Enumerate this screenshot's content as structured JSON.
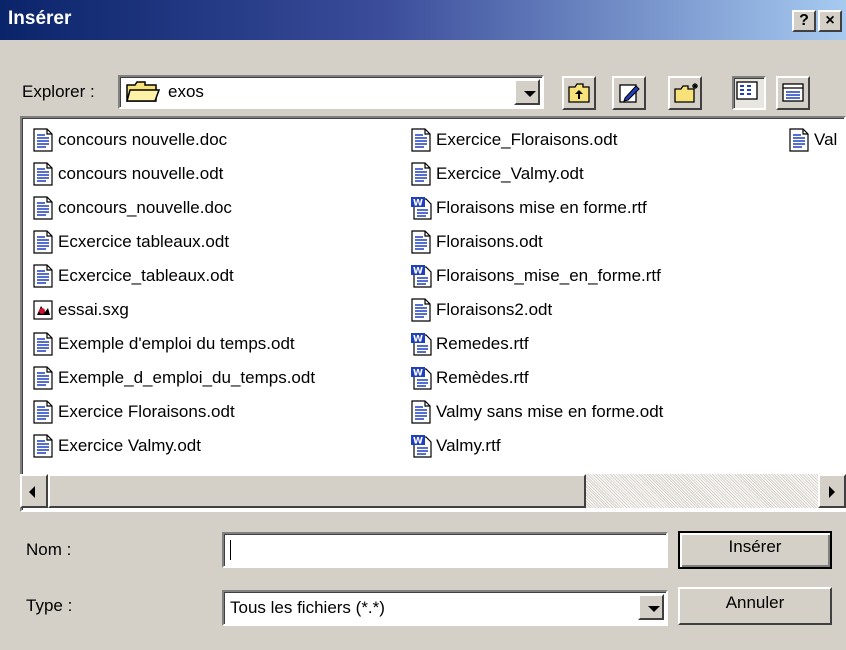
{
  "window": {
    "title": "Insérer",
    "help_button": "?",
    "close_button": "×"
  },
  "explorer": {
    "label": "Explorer :",
    "folder": "exos",
    "folder_icon": "folder-icon"
  },
  "toolbar": [
    {
      "name": "up-one-level-icon"
    },
    {
      "name": "edit-pencil-icon"
    },
    {
      "name": "new-folder-icon"
    },
    {
      "name": "list-view-icon"
    },
    {
      "name": "details-view-icon"
    }
  ],
  "files": {
    "col1": [
      {
        "name": "concours nouvelle.doc",
        "icon": "document-icon"
      },
      {
        "name": "concours nouvelle.odt",
        "icon": "document-icon"
      },
      {
        "name": "concours_nouvelle.doc",
        "icon": "document-icon"
      },
      {
        "name": "Ecxercice tableaux.odt",
        "icon": "document-icon"
      },
      {
        "name": "Ecxercice_tableaux.odt",
        "icon": "document-icon"
      },
      {
        "name": "essai.sxg",
        "icon": "sxg-file-icon"
      },
      {
        "name": "Exemple d'emploi du temps.odt",
        "icon": "document-icon"
      },
      {
        "name": "Exemple_d_emploi_du_temps.odt",
        "icon": "document-icon"
      },
      {
        "name": "Exercice Floraisons.odt",
        "icon": "document-icon"
      },
      {
        "name": "Exercice Valmy.odt",
        "icon": "document-icon"
      }
    ],
    "col2": [
      {
        "name": "Exercice_Floraisons.odt",
        "icon": "document-icon"
      },
      {
        "name": "Exercice_Valmy.odt",
        "icon": "document-icon"
      },
      {
        "name": "Floraisons mise en forme.rtf",
        "icon": "rtf-file-icon"
      },
      {
        "name": "Floraisons.odt",
        "icon": "document-icon"
      },
      {
        "name": "Floraisons_mise_en_forme.rtf",
        "icon": "rtf-file-icon"
      },
      {
        "name": "Floraisons2.odt",
        "icon": "document-icon"
      },
      {
        "name": "Remedes.rtf",
        "icon": "rtf-file-icon"
      },
      {
        "name": "Remèdes.rtf",
        "icon": "rtf-file-icon"
      },
      {
        "name": "Valmy sans mise en forme.odt",
        "icon": "document-icon"
      },
      {
        "name": "Valmy.rtf",
        "icon": "rtf-file-icon"
      }
    ],
    "col3": [
      {
        "name": "Val",
        "icon": "document-icon"
      }
    ]
  },
  "form": {
    "name_label": "Nom :",
    "name_value": "",
    "type_label": "Type :",
    "type_value": "Tous les fichiers (*.*)"
  },
  "buttons": {
    "insert": "Insérer",
    "cancel": "Annuler"
  },
  "colors": {
    "titlebar_start": "#0a246a",
    "titlebar_end": "#a6caf0",
    "dialog_bg": "#d4d0c8",
    "doc_icon_blue": "#1f3fbf"
  }
}
